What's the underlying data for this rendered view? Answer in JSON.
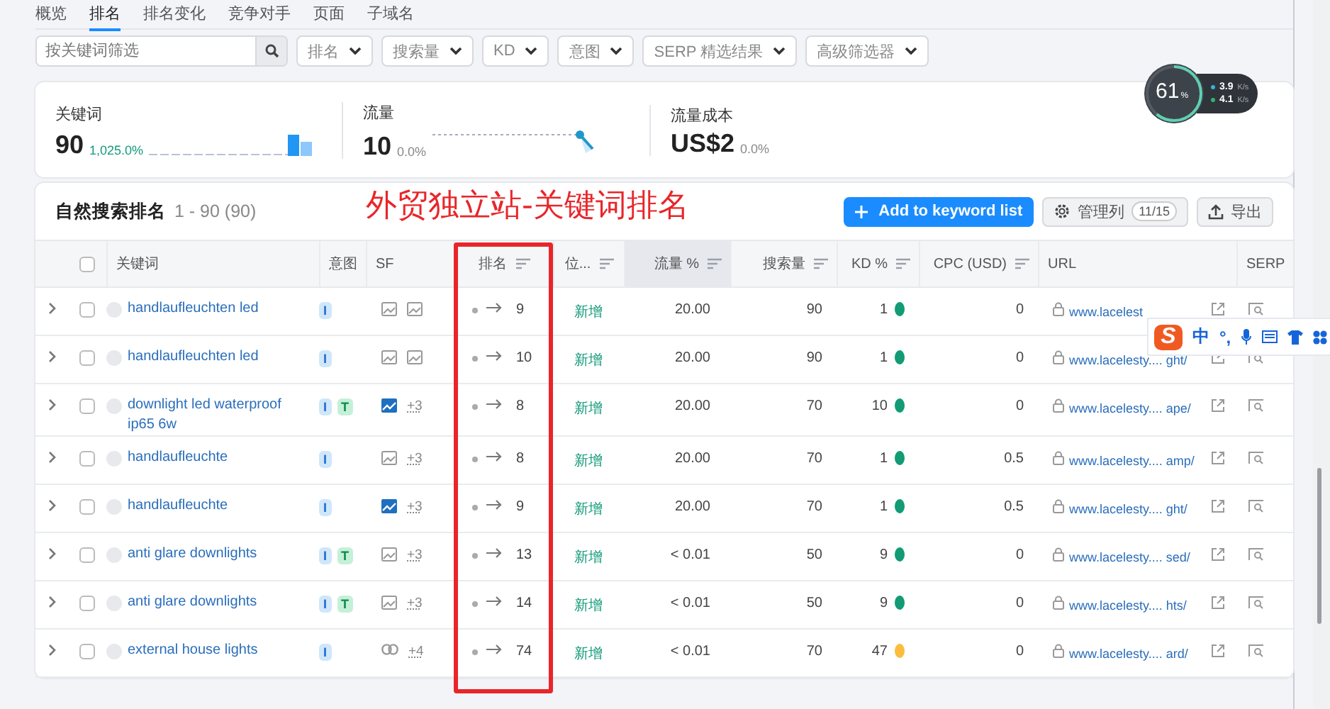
{
  "tabs": [
    {
      "label": "概览",
      "selected": false
    },
    {
      "label": "排名",
      "selected": true
    },
    {
      "label": "排名变化",
      "selected": false
    },
    {
      "label": "竞争对手",
      "selected": false
    },
    {
      "label": "页面",
      "selected": false
    },
    {
      "label": "子域名",
      "selected": false
    }
  ],
  "search": {
    "placeholder": "按关键词筛选"
  },
  "filters": [
    "排名",
    "搜索量",
    "KD",
    "意图",
    "SERP 精选结果",
    "高级筛选器"
  ],
  "stats": [
    {
      "label": "关键词",
      "value": "90",
      "change": "1,025.0%",
      "positive": true,
      "kind": "bars"
    },
    {
      "label": "流量",
      "value": "10",
      "change": "0.0%",
      "positive": false,
      "kind": "line"
    },
    {
      "label": "流量成本",
      "value": "US$2",
      "change": "0.0%",
      "positive": false,
      "kind": "none"
    }
  ],
  "table": {
    "title": "自然搜索排名",
    "range": "1 - 90 (90)",
    "add_button": "Add to keyword list",
    "columns_button": "管理列",
    "columns_count": "11/15",
    "export_button": "导出",
    "all_checked": false,
    "columns": [
      {
        "label": "关键词",
        "sortable": false,
        "selected": false
      },
      {
        "label": "意图",
        "sortable": false,
        "selected": false
      },
      {
        "label": "SF",
        "sortable": false,
        "selected": false
      },
      {
        "label": "排名",
        "sortable": true,
        "selected": false
      },
      {
        "label": "位...",
        "sortable": true,
        "selected": false
      },
      {
        "label": "流量 %",
        "sortable": true,
        "selected": true
      },
      {
        "label": "搜索量",
        "sortable": true,
        "selected": false
      },
      {
        "label": "KD %",
        "sortable": true,
        "selected": false
      },
      {
        "label": "CPC (USD)",
        "sortable": true,
        "selected": false
      },
      {
        "label": "URL",
        "sortable": false,
        "selected": false
      },
      {
        "label": "SERP",
        "sortable": false,
        "selected": false
      }
    ],
    "rows": [
      {
        "keyword": "handlaufleuchten led",
        "intents": [
          {
            "label": "I",
            "kind": "info"
          }
        ],
        "sf": [
          {
            "kind": "image",
            "highlighted": false
          },
          {
            "kind": "image",
            "highlighted": false
          }
        ],
        "rank": "9",
        "position": "新增",
        "traffic": "20.00",
        "volume": "90",
        "kd": "1",
        "color": "#129b74",
        "cpc": "0",
        "url": "www.lacelest",
        "checked": false,
        "expanded": false
      },
      {
        "keyword": "handlaufleuchten led",
        "intents": [
          {
            "label": "I",
            "kind": "info"
          }
        ],
        "sf": [
          {
            "kind": "image",
            "highlighted": false
          },
          {
            "kind": "image",
            "highlighted": false
          }
        ],
        "rank": "10",
        "position": "新增",
        "traffic": "20.00",
        "volume": "90",
        "kd": "1",
        "color": "#129b74",
        "cpc": "0",
        "url": "www.lacelesty.... ght/",
        "checked": false,
        "expanded": false
      },
      {
        "keyword": "downlight led waterproof ip65 6w",
        "intents": [
          {
            "label": "I",
            "kind": "info"
          },
          {
            "label": "T",
            "kind": "trans"
          }
        ],
        "sf": [
          {
            "kind": "image",
            "highlighted": true
          }
        ],
        "sf_more": "+3",
        "rank": "8",
        "position": "新增",
        "traffic": "20.00",
        "volume": "70",
        "kd": "10",
        "color": "#129b74",
        "cpc": "0",
        "url": "www.lacelesty.... ape/",
        "checked": false,
        "expanded": false
      },
      {
        "keyword": "handlaufleuchte",
        "intents": [
          {
            "label": "I",
            "kind": "info"
          }
        ],
        "sf": [
          {
            "kind": "image",
            "highlighted": false
          }
        ],
        "sf_more": "+3",
        "rank": "8",
        "position": "新增",
        "traffic": "20.00",
        "volume": "70",
        "kd": "1",
        "color": "#129b74",
        "cpc": "0.5",
        "url": "www.lacelesty.... amp/",
        "checked": false,
        "expanded": false
      },
      {
        "keyword": "handlaufleuchte",
        "intents": [
          {
            "label": "I",
            "kind": "info"
          }
        ],
        "sf": [
          {
            "kind": "image",
            "highlighted": true
          }
        ],
        "sf_more": "+3",
        "rank": "9",
        "position": "新增",
        "traffic": "20.00",
        "volume": "70",
        "kd": "1",
        "color": "#129b74",
        "cpc": "0.5",
        "url": "www.lacelesty.... ght/",
        "checked": false,
        "expanded": false
      },
      {
        "keyword": "anti glare downlights",
        "intents": [
          {
            "label": "I",
            "kind": "info"
          },
          {
            "label": "T",
            "kind": "trans"
          }
        ],
        "sf": [
          {
            "kind": "image",
            "highlighted": false
          }
        ],
        "sf_more": "+3",
        "rank": "13",
        "position": "新增",
        "traffic": "< 0.01",
        "volume": "50",
        "kd": "9",
        "color": "#129b74",
        "cpc": "0",
        "url": "www.lacelesty.... sed/",
        "checked": false,
        "expanded": false
      },
      {
        "keyword": "anti glare downlights",
        "intents": [
          {
            "label": "I",
            "kind": "info"
          },
          {
            "label": "T",
            "kind": "trans"
          }
        ],
        "sf": [
          {
            "kind": "image",
            "highlighted": false
          }
        ],
        "sf_more": "+3",
        "rank": "14",
        "position": "新增",
        "traffic": "< 0.01",
        "volume": "50",
        "kd": "9",
        "color": "#129b74",
        "cpc": "0",
        "url": "www.lacelesty.... hts/",
        "checked": false,
        "expanded": false
      },
      {
        "keyword": "external house lights",
        "intents": [
          {
            "label": "I",
            "kind": "info"
          }
        ],
        "sf": [
          {
            "kind": "link",
            "highlighted": false
          }
        ],
        "sf_more": "+4",
        "rank": "74",
        "position": "新增",
        "traffic": "< 0.01",
        "volume": "70",
        "kd": "47",
        "color": "#fbbd3c",
        "cpc": "0",
        "url": "www.lacelesty.... ard/",
        "checked": false,
        "expanded": false
      }
    ]
  },
  "annotation": {
    "text": "外贸独立站-关键词排名"
  },
  "speed_widget": {
    "percent": "61",
    "percent_unit": "%",
    "level": 0.61,
    "upload": "3.9",
    "upload_unit": "K/s",
    "download": "4.1",
    "download_unit": "K/s"
  },
  "ime_toolbar": {
    "logo": "S",
    "mode": "中",
    "punct": "°,"
  }
}
